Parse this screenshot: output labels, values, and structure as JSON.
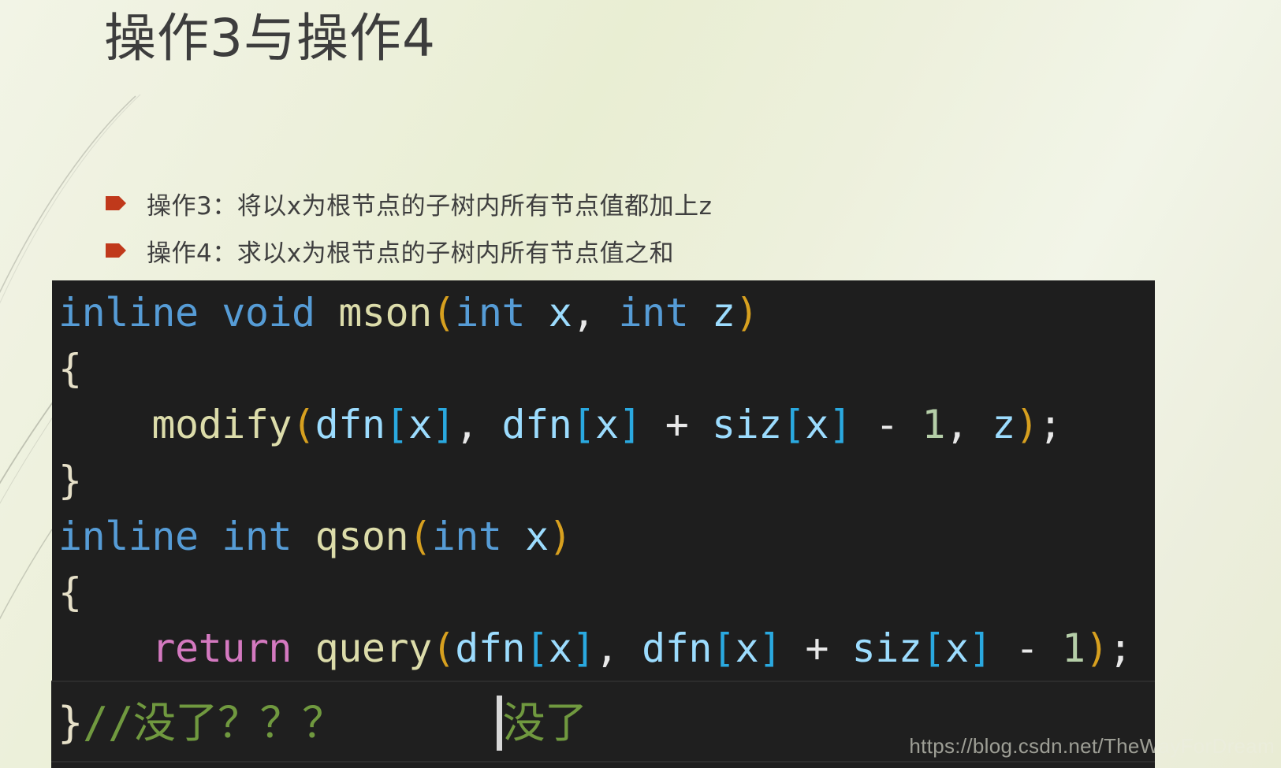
{
  "slide": {
    "title": "操作3与操作4",
    "background_color_top": "#eaeed6",
    "background_color_bottom": "#f5f7ec",
    "accent_color": "#c0391b"
  },
  "bullets": [
    {
      "marker": "arrow-pentagon-bullet",
      "text": "操作3：将以x为根节点的子树内所有节点值都加上z"
    },
    {
      "marker": "arrow-pentagon-bullet",
      "text": "操作4：求以x为根节点的子树内所有节点值之和"
    }
  ],
  "code_panel": {
    "background_color": "#1e1e1e",
    "lines": [
      {
        "tokens": [
          {
            "t": "inline",
            "c": "kw"
          },
          {
            "t": " ",
            "c": "punc"
          },
          {
            "t": "void",
            "c": "kw"
          },
          {
            "t": " ",
            "c": "punc"
          },
          {
            "t": "mson",
            "c": "fn"
          },
          {
            "t": "(",
            "c": "paren"
          },
          {
            "t": "int",
            "c": "kw"
          },
          {
            "t": " ",
            "c": "punc"
          },
          {
            "t": "x",
            "c": "id"
          },
          {
            "t": ",",
            "c": "punc"
          },
          {
            "t": " ",
            "c": "punc"
          },
          {
            "t": "int",
            "c": "kw"
          },
          {
            "t": " ",
            "c": "punc"
          },
          {
            "t": "z",
            "c": "id"
          },
          {
            "t": ")",
            "c": "paren"
          }
        ]
      },
      {
        "tokens": [
          {
            "t": "{",
            "c": "brace"
          }
        ]
      },
      {
        "tokens": [
          {
            "t": "    ",
            "c": "punc"
          },
          {
            "t": "modify",
            "c": "fn"
          },
          {
            "t": "(",
            "c": "paren"
          },
          {
            "t": "dfn",
            "c": "id"
          },
          {
            "t": "[",
            "c": "brk"
          },
          {
            "t": "x",
            "c": "id"
          },
          {
            "t": "]",
            "c": "brk"
          },
          {
            "t": ", ",
            "c": "punc"
          },
          {
            "t": "dfn",
            "c": "id"
          },
          {
            "t": "[",
            "c": "brk"
          },
          {
            "t": "x",
            "c": "id"
          },
          {
            "t": "]",
            "c": "brk"
          },
          {
            "t": " + ",
            "c": "punc"
          },
          {
            "t": "siz",
            "c": "id"
          },
          {
            "t": "[",
            "c": "brk"
          },
          {
            "t": "x",
            "c": "id"
          },
          {
            "t": "]",
            "c": "brk"
          },
          {
            "t": " - ",
            "c": "punc"
          },
          {
            "t": "1",
            "c": "num"
          },
          {
            "t": ", ",
            "c": "punc"
          },
          {
            "t": "z",
            "c": "id"
          },
          {
            "t": ")",
            "c": "paren"
          },
          {
            "t": ";",
            "c": "punc"
          }
        ]
      },
      {
        "tokens": [
          {
            "t": "}",
            "c": "brace"
          }
        ]
      },
      {
        "tokens": [
          {
            "t": "inline",
            "c": "kw"
          },
          {
            "t": " ",
            "c": "punc"
          },
          {
            "t": "int",
            "c": "kw"
          },
          {
            "t": " ",
            "c": "punc"
          },
          {
            "t": "qson",
            "c": "fn"
          },
          {
            "t": "(",
            "c": "paren"
          },
          {
            "t": "int",
            "c": "kw"
          },
          {
            "t": " ",
            "c": "punc"
          },
          {
            "t": "x",
            "c": "id"
          },
          {
            "t": ")",
            "c": "paren"
          }
        ]
      },
      {
        "tokens": [
          {
            "t": "{",
            "c": "brace"
          }
        ]
      },
      {
        "tokens": [
          {
            "t": "    ",
            "c": "punc"
          },
          {
            "t": "return",
            "c": "ret"
          },
          {
            "t": " ",
            "c": "punc"
          },
          {
            "t": "query",
            "c": "fn"
          },
          {
            "t": "(",
            "c": "paren"
          },
          {
            "t": "dfn",
            "c": "id"
          },
          {
            "t": "[",
            "c": "brk"
          },
          {
            "t": "x",
            "c": "id"
          },
          {
            "t": "]",
            "c": "brk"
          },
          {
            "t": ", ",
            "c": "punc"
          },
          {
            "t": "dfn",
            "c": "id"
          },
          {
            "t": "[",
            "c": "brk"
          },
          {
            "t": "x",
            "c": "id"
          },
          {
            "t": "]",
            "c": "brk"
          },
          {
            "t": " + ",
            "c": "punc"
          },
          {
            "t": "siz",
            "c": "id"
          },
          {
            "t": "[",
            "c": "brk"
          },
          {
            "t": "x",
            "c": "id"
          },
          {
            "t": "]",
            "c": "brk"
          },
          {
            "t": " - ",
            "c": "punc"
          },
          {
            "t": "1",
            "c": "num"
          },
          {
            "t": ")",
            "c": "paren"
          },
          {
            "t": ";",
            "c": "punc"
          }
        ]
      }
    ]
  },
  "code_strip": {
    "background_color": "#1f1f1f",
    "before_caret": [
      {
        "t": "}",
        "c": "brace"
      },
      {
        "t": "//没了？？？",
        "c": "cmt"
      },
      {
        "t": "      ",
        "c": "punc"
      }
    ],
    "after_caret": [
      {
        "t": "没了",
        "c": "cmt"
      }
    ],
    "caret": "text-caret"
  },
  "watermark": {
    "text": "https://blog.csdn.net/TheWayForDream"
  }
}
